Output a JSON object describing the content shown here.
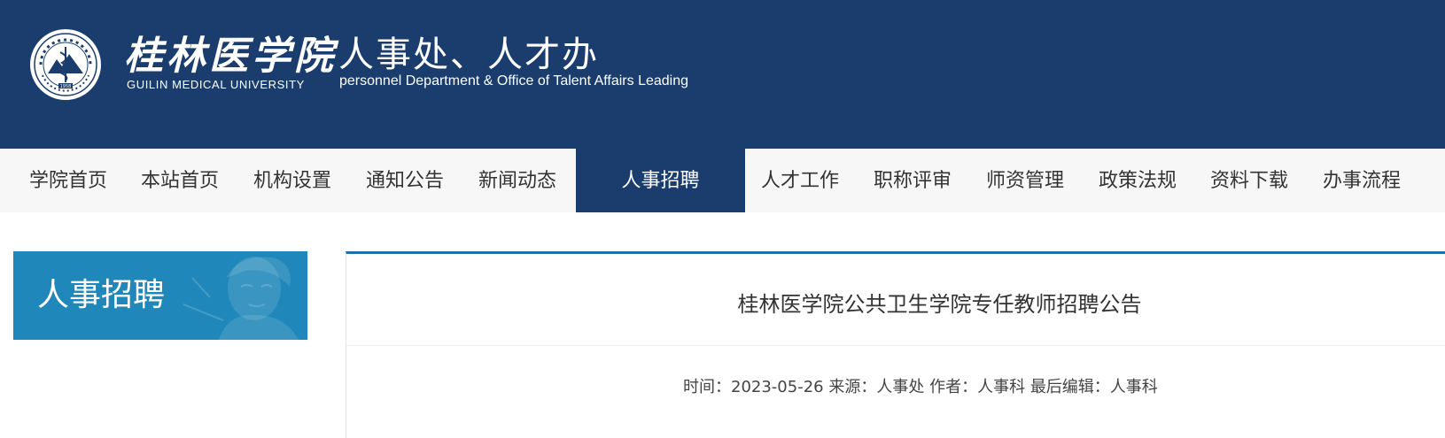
{
  "header": {
    "school_name_cn": "桂林医学院",
    "school_name_en": "GUILIN MEDICAL UNIVERSITY",
    "dept_name_cn": "人事处、人才办",
    "dept_name_en": "personnel Department & Office of Talent Affairs Leading",
    "logo_icon": "university-seal-icon",
    "emblem_year": "1958",
    "colors": {
      "header_bg": "#1a3d6d"
    }
  },
  "nav": {
    "items": [
      {
        "label": "学院首页",
        "active": false
      },
      {
        "label": "本站首页",
        "active": false
      },
      {
        "label": "机构设置",
        "active": false
      },
      {
        "label": "通知公告",
        "active": false
      },
      {
        "label": "新闻动态",
        "active": false
      },
      {
        "label": "人事招聘",
        "active": true
      },
      {
        "label": "人才工作",
        "active": false
      },
      {
        "label": "职称评审",
        "active": false
      },
      {
        "label": "师资管理",
        "active": false
      },
      {
        "label": "政策法规",
        "active": false
      },
      {
        "label": "资料下载",
        "active": false
      },
      {
        "label": "办事流程",
        "active": false
      }
    ],
    "colors": {
      "bg": "#f7f7f7",
      "active_bg": "#1a3d6d"
    }
  },
  "sidebar": {
    "title": "人事招聘",
    "colors": {
      "bg": "#1f87b9"
    }
  },
  "article": {
    "title": "桂林医学院公共卫生学院专任教师招聘公告",
    "meta": {
      "time_label": "时间：",
      "time_value": "2023-05-26",
      "source_label": "来源：",
      "source_value": "人事处",
      "author_label": "作者：",
      "author_value": "人事科",
      "editor_label": "最后编辑：",
      "editor_value": "人事科"
    },
    "colors": {
      "top_border": "#1f6fa9"
    }
  }
}
